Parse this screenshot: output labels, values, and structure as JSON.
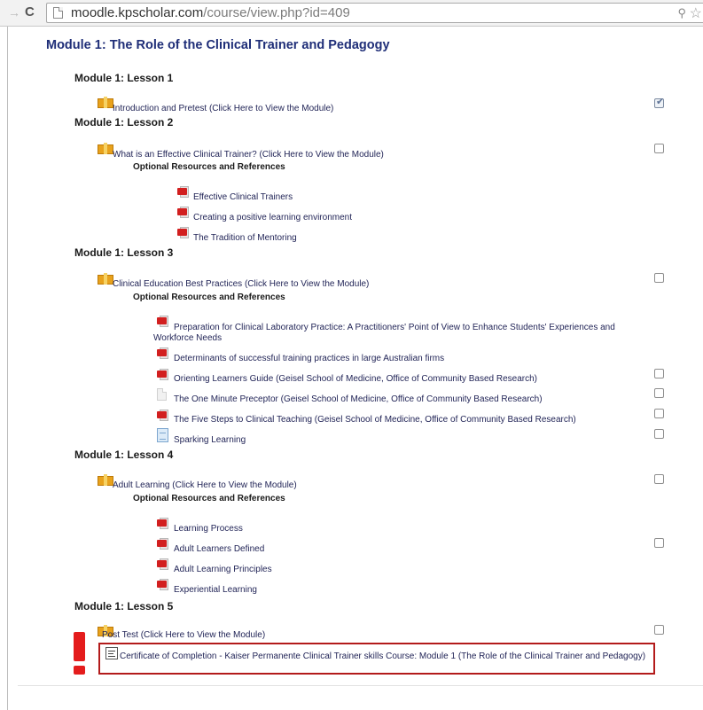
{
  "browser": {
    "url_host": "moodle.kpscholar.com",
    "url_path": "/course/view.php?id=409"
  },
  "module_title": "Module 1: The Role of the Clinical Trainer and Pedagogy",
  "lessons": [
    {
      "title": "Module 1: Lesson 1"
    },
    {
      "title": "Module 1: Lesson 2"
    },
    {
      "title": "Module 1: Lesson 3"
    },
    {
      "title": "Module 1: Lesson 4"
    },
    {
      "title": "Module 1: Lesson 5"
    }
  ],
  "activities": {
    "lesson1_intro": {
      "label": "Introduction and Pretest (Click Here to View the Module)",
      "completed": true
    },
    "lesson2_main": {
      "label": "What is an Effective Clinical Trainer? (Click Here to View the Module)",
      "completed": false
    },
    "lesson3_main": {
      "label": "Clinical Education Best Practices (Click Here to View the Module)",
      "completed": false
    },
    "lesson4_main": {
      "label": "Adult Learning (Click Here to View the Module)",
      "completed": false
    },
    "lesson5_main": {
      "label": "Post Test (Click Here to View the Module)",
      "completed": false
    }
  },
  "optional_resources_label": "Optional Resources and References",
  "resources": {
    "l2": [
      "Effective Clinical Trainers",
      "Creating a positive learning environment",
      "The Tradition of Mentoring"
    ],
    "l3": [
      "Preparation for Clinical Laboratory Practice: A Practitioners' Point of View to Enhance Students' Experiences and Workforce Needs",
      "Determinants of successful training practices in large Australian firms",
      "Orienting Learners Guide (Geisel School of Medicine, Office of Community Based Research)",
      "The One Minute Preceptor (Geisel School of Medicine, Office of Community Based Research)",
      "The Five Steps to Clinical Teaching (Geisel School of Medicine, Office of Community Based Research)",
      "Sparking Learning"
    ],
    "l4": [
      "Learning Process",
      "Adult Learners Defined",
      "Adult Learning Principles",
      "Experiential Learning"
    ]
  },
  "certificate": {
    "label": "Certificate of Completion - Kaiser Permanente Clinical Trainer skills Course: Module 1 (The Role of the Clinical Trainer and Pedagogy)"
  },
  "colors": {
    "title": "#1f2e78",
    "link": "#1f2255",
    "highlight": "#b31b1b",
    "exclamation": "#e41c1c"
  },
  "icons": {
    "package": "package-icon",
    "pdf": "pdf-icon",
    "file": "file-icon",
    "document": "document-icon",
    "certificate": "certificate-icon",
    "alert": "exclamation-icon"
  }
}
